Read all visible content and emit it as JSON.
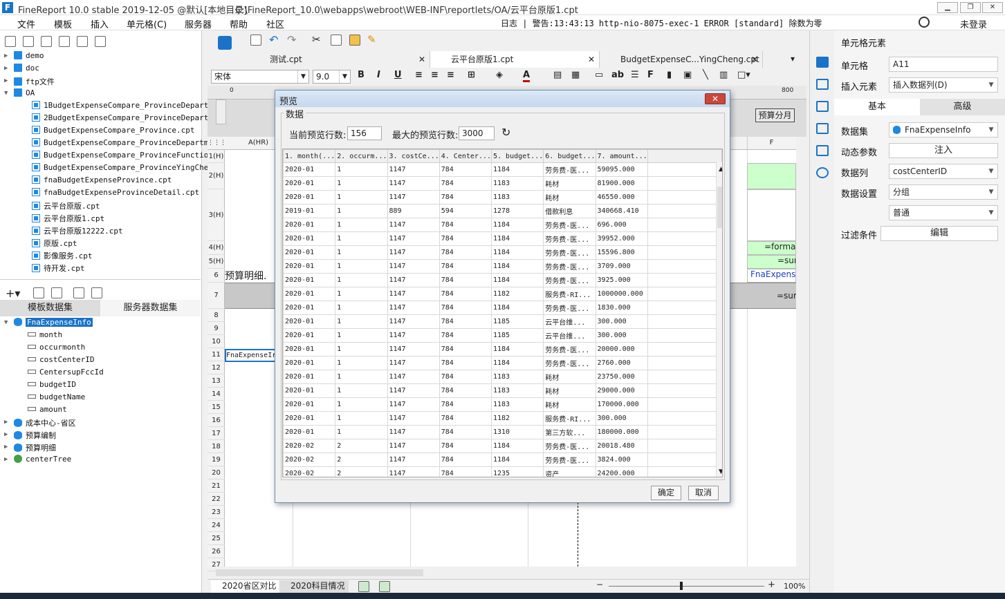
{
  "window": {
    "title": "FineReport 10.0 stable 2019-12-05 @默认[本地目录]",
    "path": "C:\\FineReport_10.0\\webapps\\webroot\\WEB-INF\\reportlets/OA/云平台原版1.cpt"
  },
  "menu": [
    "文件",
    "模板",
    "插入",
    "单元格(C)",
    "服务器",
    "帮助",
    "社区"
  ],
  "log": "日志 | 警告:13:43:13 http-nio-8075-exec-1 ERROR [standard] 除数为零",
  "login": "未登录",
  "tree": [
    {
      "label": "demo",
      "type": "folder",
      "level": 0
    },
    {
      "label": "doc",
      "type": "folder",
      "level": 0
    },
    {
      "label": "ftp文件",
      "type": "folder",
      "level": 0
    },
    {
      "label": "OA",
      "type": "folder",
      "level": 0
    },
    {
      "label": "1BudgetExpenseCompare_ProvinceDepartm",
      "type": "file",
      "level": 1
    },
    {
      "label": "2BudgetExpenseCompare_ProvinceDepartm",
      "type": "file",
      "level": 1
    },
    {
      "label": "BudgetExpenseCompare_Province.cpt",
      "type": "file",
      "level": 1
    },
    {
      "label": "BudgetExpenseCompare_ProvinceDepartme",
      "type": "file",
      "level": 1
    },
    {
      "label": "BudgetExpenseCompare_ProvinceFunction",
      "type": "file",
      "level": 1
    },
    {
      "label": "BudgetExpenseCompare_ProvinceYingCher",
      "type": "file",
      "level": 1
    },
    {
      "label": "fnaBudgetExpenseProvince.cpt",
      "type": "file",
      "level": 1
    },
    {
      "label": "fnaBudgetExpenseProvinceDetail.cpt",
      "type": "file",
      "level": 1
    },
    {
      "label": "云平台原版.cpt",
      "type": "file",
      "level": 1
    },
    {
      "label": "云平台原版1.cpt",
      "type": "file",
      "level": 1
    },
    {
      "label": "云平台原版12222.cpt",
      "type": "file",
      "level": 1
    },
    {
      "label": "原版.cpt",
      "type": "file",
      "level": 1
    },
    {
      "label": "影像服务.cpt",
      "type": "file",
      "level": 1
    },
    {
      "label": "待开发.cpt",
      "type": "file",
      "level": 1
    }
  ],
  "dataset_tabs": [
    "模板数据集",
    "服务器数据集"
  ],
  "datasets": [
    {
      "label": "FnaExpenseInfo",
      "type": "db",
      "level": 0
    },
    {
      "label": "month",
      "type": "field",
      "level": 1
    },
    {
      "label": "occurmonth",
      "type": "field",
      "level": 1
    },
    {
      "label": "costCenterID",
      "type": "field",
      "level": 1
    },
    {
      "label": "CentersupFccId",
      "type": "field",
      "level": 1
    },
    {
      "label": "budgetID",
      "type": "field",
      "level": 1
    },
    {
      "label": "budgetName",
      "type": "field",
      "level": 1
    },
    {
      "label": "amount",
      "type": "field",
      "level": 1
    },
    {
      "label": "成本中心-省区",
      "type": "db",
      "level": 0
    },
    {
      "label": "预算编制",
      "type": "db",
      "level": 0
    },
    {
      "label": "预算明细",
      "type": "db",
      "level": 0
    },
    {
      "label": "centerTree",
      "type": "tree",
      "level": 0
    }
  ],
  "file_tabs": [
    {
      "label": "测试.cpt"
    },
    {
      "label": "云平台原版1.cpt"
    },
    {
      "label": "BudgetExpenseC...YingCheng.cpt"
    }
  ],
  "format": {
    "font": "宋体",
    "size": "9.0"
  },
  "ruler": {
    "left_mark": "0",
    "right_mark": "800"
  },
  "designer": {
    "label": "预算分月"
  },
  "columns": {
    "a": "A(HR)",
    "f": "F"
  },
  "rows": [
    "1(H)",
    "2(H)",
    "3(H)",
    "4(H)",
    "5(H)",
    "6",
    "7",
    "8",
    "9",
    "10",
    "11",
    "12",
    "13",
    "14",
    "15",
    "16",
    "17",
    "18",
    "19",
    "20",
    "21",
    "22",
    "23",
    "24",
    "25",
    "26",
    "27"
  ],
  "cells": {
    "r6a": "预算明细.",
    "r11a": "FnaExpenseIr",
    "r4f": "=forma",
    "r5f": "=sur",
    "r6f": "FnaExpens",
    "r7f": "=sur"
  },
  "props": {
    "header": "单元格元素",
    "cell_label": "单元格",
    "cell_value": "A11",
    "insert_label": "插入元素",
    "insert_value": "插入数据列(D)",
    "tab_basic": "基本",
    "tab_advanced": "高级",
    "dataset_label": "数据集",
    "dataset_value": "FnaExpenseInfo",
    "dynparam_label": "动态参数",
    "dynparam_btn": "注入",
    "column_label": "数据列",
    "column_value": "costCenterID",
    "setting_label": "数据设置",
    "setting_value": "分组",
    "setting_value2": "普通",
    "filter_label": "过滤条件",
    "filter_btn": "编辑"
  },
  "sheets": [
    "2020省区对比",
    "2020科目情况"
  ],
  "zoom": "100%",
  "dialog": {
    "title": "预览",
    "group": "数据",
    "current_rows_label": "当前预览行数:",
    "current_rows": "156",
    "max_rows_label": "最大的预览行数:",
    "max_rows": "3000",
    "ok": "确定",
    "cancel": "取消",
    "headers": [
      "1. month(...",
      "2. occurm...",
      "3. costCe...",
      "4. Center...",
      "5. budget...",
      "6. budget...",
      "7. amount..."
    ],
    "rows": [
      [
        "2020-01",
        "1",
        "1147",
        "784",
        "1184",
        "劳务费-医...",
        "59095.000"
      ],
      [
        "2020-01",
        "1",
        "1147",
        "784",
        "1183",
        "耗材",
        "81900.000"
      ],
      [
        "2020-01",
        "1",
        "1147",
        "784",
        "1183",
        "耗材",
        "46550.000"
      ],
      [
        "2019-01",
        "1",
        "889",
        "594",
        "1278",
        "借款利息",
        "340668.410"
      ],
      [
        "2020-01",
        "1",
        "1147",
        "784",
        "1184",
        "劳务费-医...",
        "696.000"
      ],
      [
        "2020-01",
        "1",
        "1147",
        "784",
        "1184",
        "劳务费-医...",
        "39952.000"
      ],
      [
        "2020-01",
        "1",
        "1147",
        "784",
        "1184",
        "劳务费-医...",
        "15596.800"
      ],
      [
        "2020-01",
        "1",
        "1147",
        "784",
        "1184",
        "劳务费-医...",
        "3709.000"
      ],
      [
        "2020-01",
        "1",
        "1147",
        "784",
        "1184",
        "劳务费-医...",
        "3925.000"
      ],
      [
        "2020-01",
        "1",
        "1147",
        "784",
        "1182",
        "服务费-RI...",
        "1000000.000"
      ],
      [
        "2020-01",
        "1",
        "1147",
        "784",
        "1184",
        "劳务费-医...",
        "1830.000"
      ],
      [
        "2020-01",
        "1",
        "1147",
        "784",
        "1185",
        "云平台维...",
        "300.000"
      ],
      [
        "2020-01",
        "1",
        "1147",
        "784",
        "1185",
        "云平台维...",
        "300.000"
      ],
      [
        "2020-01",
        "1",
        "1147",
        "784",
        "1184",
        "劳务费-医...",
        "20000.000"
      ],
      [
        "2020-01",
        "1",
        "1147",
        "784",
        "1184",
        "劳务费-医...",
        "2760.000"
      ],
      [
        "2020-01",
        "1",
        "1147",
        "784",
        "1183",
        "耗材",
        "23750.000"
      ],
      [
        "2020-01",
        "1",
        "1147",
        "784",
        "1183",
        "耗材",
        "29000.000"
      ],
      [
        "2020-01",
        "1",
        "1147",
        "784",
        "1183",
        "耗材",
        "170000.000"
      ],
      [
        "2020-01",
        "1",
        "1147",
        "784",
        "1182",
        "服务费-RI...",
        "300.000"
      ],
      [
        "2020-01",
        "1",
        "1147",
        "784",
        "1310",
        "第三方软...",
        "180000.000"
      ],
      [
        "2020-02",
        "2",
        "1147",
        "784",
        "1184",
        "劳务费-医...",
        "20018.480"
      ],
      [
        "2020-02",
        "2",
        "1147",
        "784",
        "1184",
        "劳务费-医...",
        "3824.000"
      ],
      [
        "2020-02",
        "2",
        "1147",
        "784",
        "1235",
        "资产",
        "24200.000"
      ]
    ]
  }
}
